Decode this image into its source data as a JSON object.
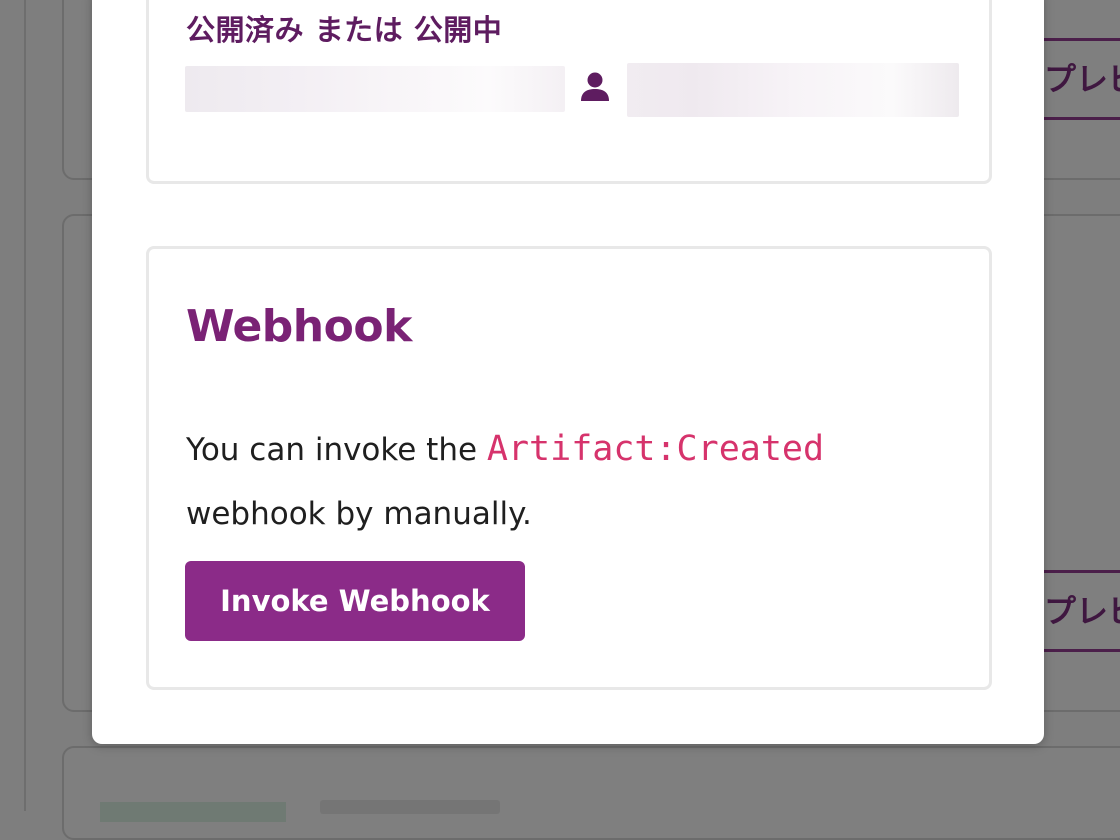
{
  "background": {
    "preview_label_1": "プレビ",
    "preview_label_2": "プレビ"
  },
  "modal": {
    "status": {
      "title": "公開済み または 公開中",
      "user_icon": "user-icon"
    },
    "webhook": {
      "title": "Webhook",
      "description_before": "You can invoke the ",
      "event_code": "Artifact:Created",
      "description_after": " webhook by manually.",
      "button_label": "Invoke Webhook"
    }
  },
  "colors": {
    "accent": "#8b2b88",
    "heading": "#7a2275",
    "code": "#d6336c",
    "overlay": "#7e7e7e"
  }
}
